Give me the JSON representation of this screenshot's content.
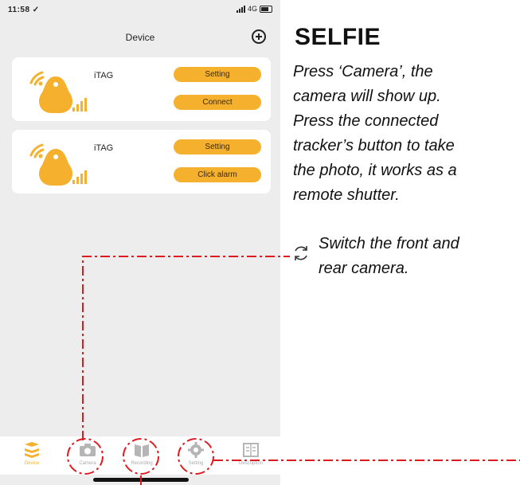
{
  "statusbar": {
    "time": "11:58 ✓",
    "carrier": "4G"
  },
  "header": {
    "title": "Device",
    "add_icon": "add-circle-icon"
  },
  "devices": [
    {
      "name": "iTAG",
      "button_top": "Setting",
      "button_bottom": "Connect"
    },
    {
      "name": "iTAG",
      "button_top": "Setting",
      "button_bottom": "Click alarm"
    }
  ],
  "tabs": [
    {
      "label": "Device",
      "icon": "layers-icon",
      "active": true
    },
    {
      "label": "Camera",
      "icon": "camera-icon",
      "active": false
    },
    {
      "label": "Recording",
      "icon": "book-icon",
      "active": false
    },
    {
      "label": "Setting",
      "icon": "gear-icon",
      "active": false
    },
    {
      "label": "Description",
      "icon": "description-icon",
      "active": false
    }
  ],
  "annotation": {
    "heading": "SELFIE",
    "lines": [
      "Press ‘Camera’, the",
      "camera will show up.",
      "Press the connected",
      "tracker’s button to take",
      "the photo, it works as a",
      "remote shutter."
    ],
    "switch_lines": [
      "Switch the front and",
      "rear camera."
    ],
    "switch_icon": "camera-switch-icon"
  },
  "colors": {
    "accent": "#f5b12d",
    "annotation_line": "#e0191f",
    "screen_bg": "#ededee"
  }
}
